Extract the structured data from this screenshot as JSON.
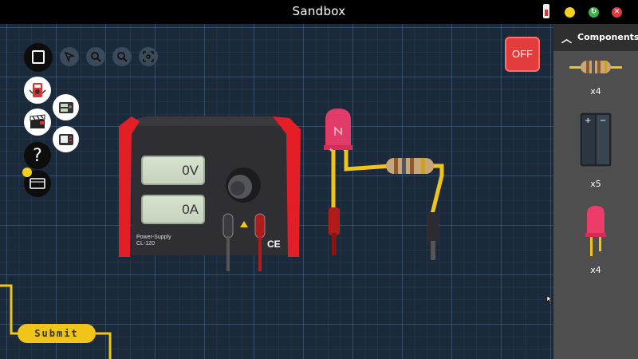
{
  "window": {
    "title": "Sandbox",
    "buttons": [
      "minimize",
      "maximize",
      "close"
    ]
  },
  "toolbar": {
    "tools": [
      "pointer-icon",
      "zoom-in-icon",
      "zoom-out-icon",
      "fit-view-icon"
    ],
    "side_buttons": [
      "book-icon",
      "multimeter-icon",
      "power-supply-icon",
      "clapperboard-icon",
      "oscilloscope-icon",
      "help-icon",
      "breadboard-icon"
    ],
    "help_label": "?"
  },
  "power_switch": {
    "label": "OFF",
    "color": "#e23c3c"
  },
  "power_supply": {
    "voltage": "0V",
    "current": "0A",
    "label_line1": "Power-Supply",
    "label_line2": "CL-120",
    "ce_mark": "CE"
  },
  "components_panel": {
    "title": "Components",
    "items": [
      {
        "name": "Resistor",
        "count": "x4"
      },
      {
        "name": "Battery",
        "count": "x5"
      },
      {
        "name": "LED",
        "count": "x4"
      }
    ]
  },
  "submit": {
    "label": "Submit"
  },
  "colors": {
    "workspace": "#1b2a3b",
    "panel": "#4e4e4e",
    "panel_header": "#2f2f2f",
    "wire": "#f0c419",
    "led": "#ec3c6a",
    "psu_red": "#e41e26"
  }
}
